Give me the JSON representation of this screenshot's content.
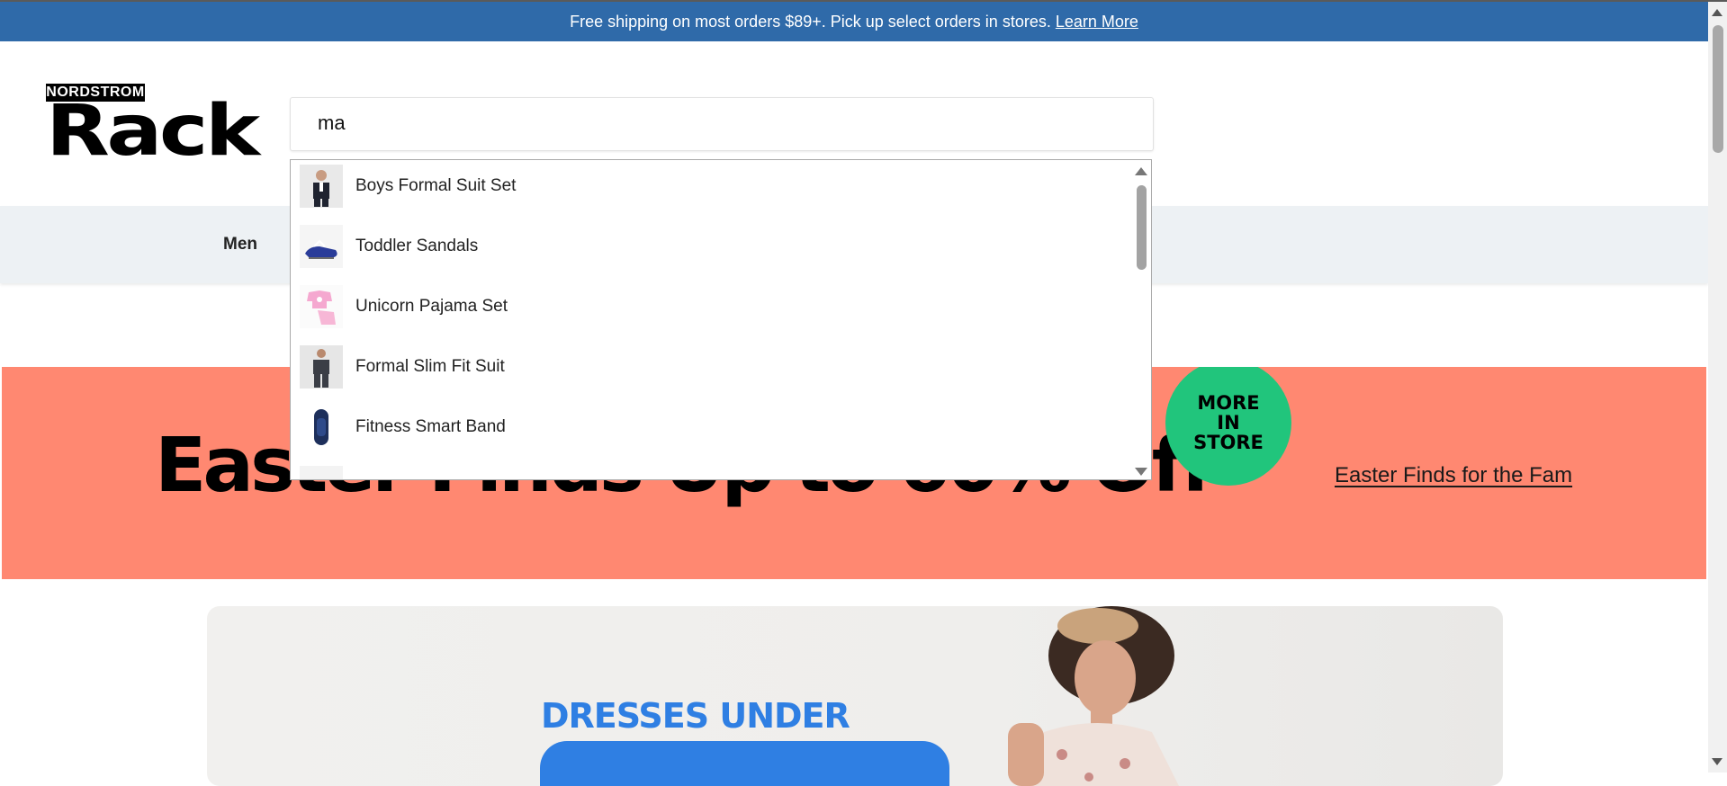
{
  "promo": {
    "text": "Free shipping on most orders $89+. Pick up select orders in stores.",
    "link": "Learn More",
    "bg": "#2f6aa9"
  },
  "logo": {
    "top": "NORDSTROM",
    "main": "Rack"
  },
  "search": {
    "value": "ma"
  },
  "suggestions": [
    {
      "label": "Boys Formal Suit Set",
      "icon": "suit-thumbnail"
    },
    {
      "label": "Toddler Sandals",
      "icon": "sandal-thumbnail"
    },
    {
      "label": "Unicorn Pajama Set",
      "icon": "pajama-thumbnail"
    },
    {
      "label": "Formal Slim Fit Suit",
      "icon": "suit-thumbnail"
    },
    {
      "label": "Fitness Smart Band",
      "icon": "smartband-thumbnail"
    }
  ],
  "nav": {
    "items": [
      "Men"
    ]
  },
  "banner": {
    "headline": "Easter Finds Up to 60% Off",
    "badge": [
      "MORE",
      "IN",
      "STORE"
    ],
    "link": "Easter Finds for the Fam",
    "bg": "#ff8871",
    "badge_color": "#21c57c"
  },
  "hero": {
    "text": "DRESSES UNDER",
    "accent": "#2f7fe3"
  }
}
